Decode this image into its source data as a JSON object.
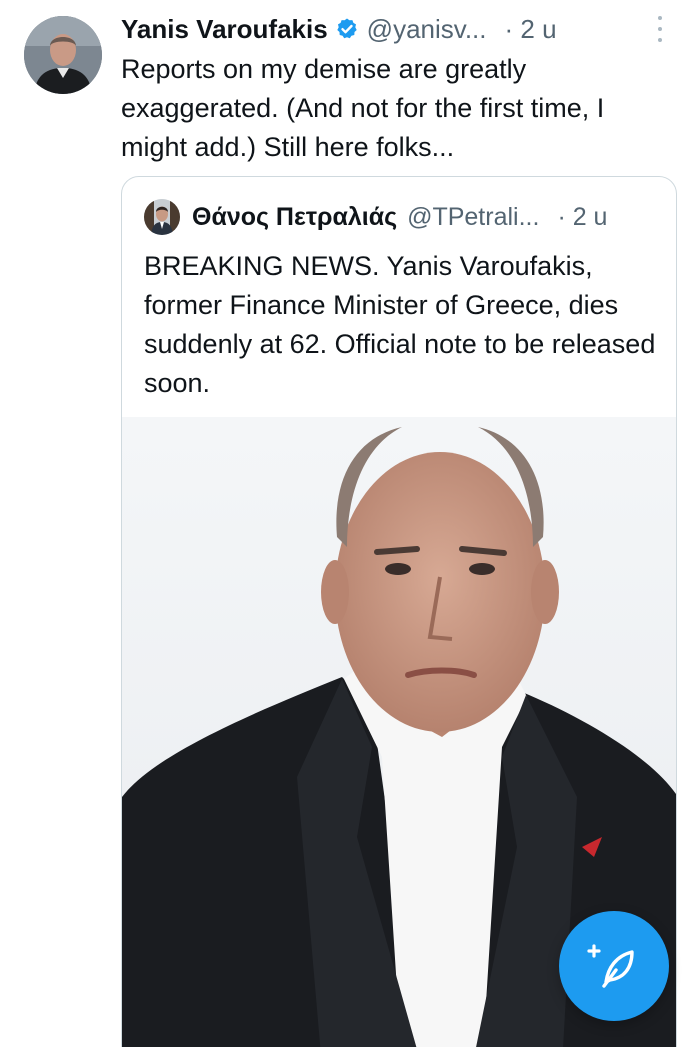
{
  "tweet": {
    "author": {
      "display_name": "Yanis Varoufakis",
      "handle": "@yanisv...",
      "verified": true,
      "avatar": "person-avatar"
    },
    "time": "· 2 u",
    "text": "Reports on my demise are greatly\nexaggerated. (And not for the first time, I\nmight add.) Still here folks...",
    "more_icon": "more-vertical-icon"
  },
  "quoted_tweet": {
    "author": {
      "display_name": "Θάνος Πετραλιάς",
      "handle": "@TPetrali...",
      "avatar": "person-avatar"
    },
    "time": "· 2 u",
    "text": "BREAKING NEWS. Yanis Varoufakis, former Finance Minister of Greece, dies suddenly at 62. Official note to be released soon.",
    "media": "portrait-photo"
  },
  "compose_button": {
    "icon": "compose-feather-icon",
    "color": "#1d9bf0"
  },
  "colors": {
    "text_primary": "#0f1419",
    "text_secondary": "#536471",
    "verified_badge": "#1d9bf0",
    "border": "#cfd9de"
  }
}
